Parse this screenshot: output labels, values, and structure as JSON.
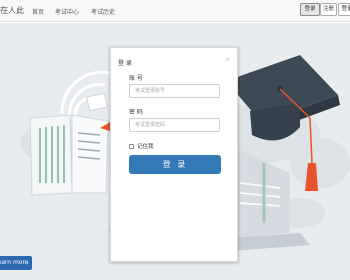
{
  "navbar": {
    "brand": "在人此",
    "items": [
      {
        "label": "首页"
      },
      {
        "label": "考试中心"
      },
      {
        "label": "考试历史"
      }
    ],
    "buttons": [
      {
        "label": "登录",
        "active": true
      },
      {
        "label": "注册",
        "active": false
      },
      {
        "label": "登录",
        "active": false
      }
    ]
  },
  "hero": {
    "learn_more": "earn more"
  },
  "modal": {
    "title": "登 录",
    "close_icon": "close-icon",
    "account_label": "账 号",
    "account_placeholder": "考试登录账号",
    "password_label": "密 码",
    "password_placeholder": "考试登录密码",
    "remember_label": "记住我",
    "login_button": "登 录"
  },
  "colors": {
    "primary": "#337ab7",
    "hero_bg": "#e9ecef",
    "cap": "#3d4a55",
    "tassel": "#e8542b"
  }
}
